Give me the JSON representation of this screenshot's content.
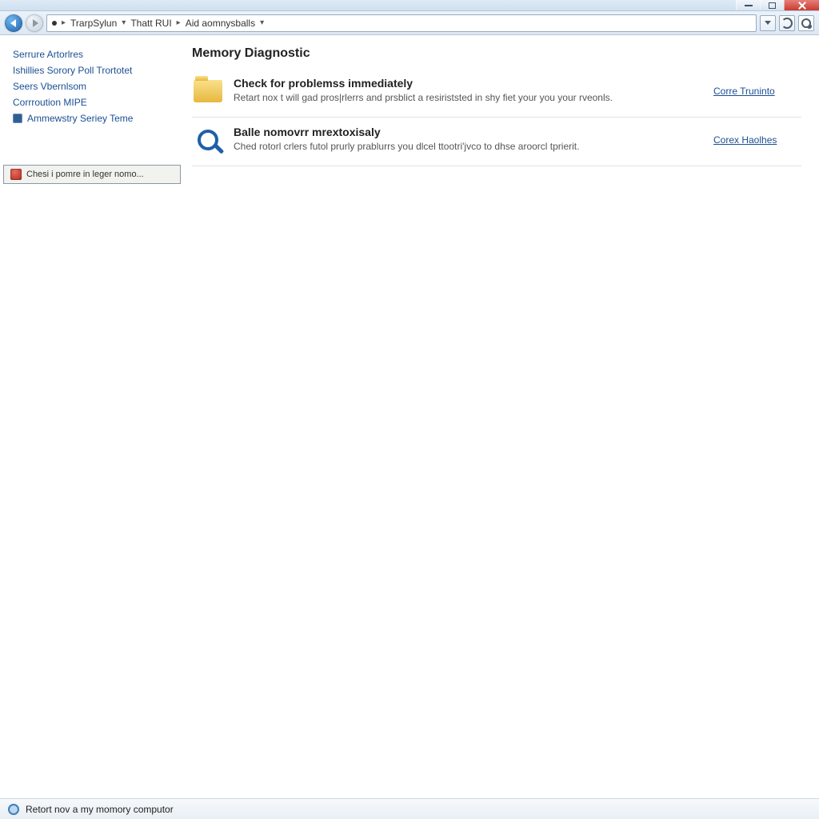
{
  "titlebar": {},
  "toolbar": {
    "crumb1": "TrarpSylun",
    "crumb2": "Thatt RUI",
    "crumb3": "Aid aomnysballs"
  },
  "sidebar": {
    "items": [
      {
        "label": "Serrure Artorlres"
      },
      {
        "label": "Ishillies Sorory Poll Trortotet"
      },
      {
        "label": "Seers Vbernlsom"
      },
      {
        "label": "Corrroution MIPE"
      },
      {
        "label": "Ammewstry Seriey Teme"
      }
    ],
    "box_label": "Chesi i pomre in leger nomo..."
  },
  "main": {
    "title": "Memory Diagnostic",
    "cards": [
      {
        "title": "Check for problemss immediately",
        "desc": "Retart nox t will gad pros|rlerrs and prsblict a resiriststed in shy fiet your you your rveonls.",
        "action": "Corre Truninto"
      },
      {
        "title": "Balle nomovrr mrextoxisaly",
        "desc": "Ched rotorl crlers futol prurly prablurrs you dlcel ttootri'jvco to dhse aroorcl tprierit.",
        "action": "Corex Haolhes"
      }
    ]
  },
  "statusbar": {
    "text": "Retort nov a my momory computor"
  }
}
